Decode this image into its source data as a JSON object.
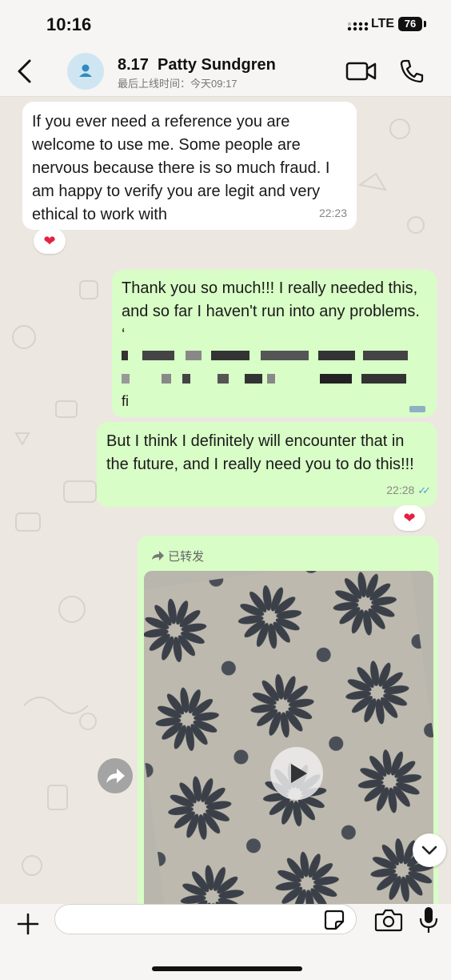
{
  "status_bar": {
    "time": "10:16",
    "network": "LTE",
    "battery": "76"
  },
  "header": {
    "contact_name": "8.17  Patty Sundgren",
    "last_seen": "最后上线时间：今天09:17"
  },
  "messages": [
    {
      "direction": "incoming",
      "text": "If you ever need a reference you are welcome to use me. Some people are nervous because there is so much fraud. I am happy to verify you are legit and very ethical to work with",
      "time": "22:23",
      "reaction": "❤"
    },
    {
      "direction": "outgoing",
      "text": "Thank you so much!!! I really needed this, and so far I haven't run into any problems. ‘",
      "blurred_tail": "fi",
      "time": ""
    },
    {
      "direction": "outgoing",
      "text": "But I think I definitely will encounter that in the future, and I really need you to do this!!!",
      "time": "22:28",
      "ticks": "✓✓",
      "reaction": "❤"
    },
    {
      "direction": "outgoing",
      "type": "video",
      "forward_label": "已转发"
    }
  ],
  "icons": [
    "back-arrow-icon",
    "avatar-person-icon",
    "video-call-icon",
    "phone-icon",
    "play-icon",
    "share-icon",
    "chevron-down-icon",
    "plus-icon",
    "sticker-icon",
    "camera-icon",
    "mic-icon"
  ],
  "colors": {
    "outgoing_bubble": "#d8fdc6",
    "incoming_bubble": "#ffffff",
    "read_ticks": "#4fa3e0",
    "reaction_heart": "#e3223f"
  },
  "composer": {
    "value": "",
    "placeholder": ""
  }
}
